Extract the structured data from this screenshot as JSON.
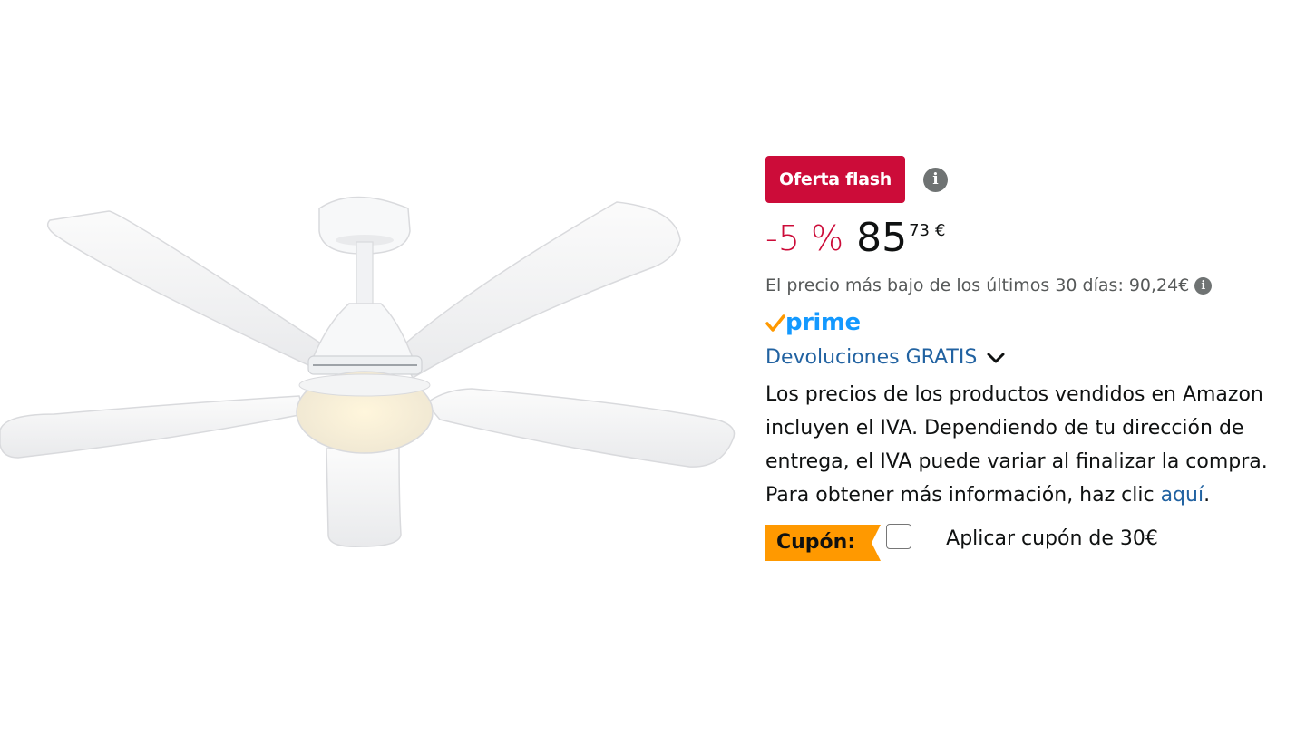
{
  "badge": {
    "label": "Oferta flash",
    "info": "i"
  },
  "price": {
    "discount": "-5 %",
    "whole": "85",
    "fraction": "73",
    "currency": "€"
  },
  "lowest_price": {
    "label": "El precio más bajo de los últimos 30 días:",
    "value": "90,24€",
    "info": "i"
  },
  "prime": {
    "label": "prime"
  },
  "returns": {
    "label": "Devoluciones GRATIS"
  },
  "vat": {
    "text": "Los precios de los productos vendidos en Amazon incluyen el IVA. Dependiendo de tu dirección de entrega, el IVA puede variar al finalizar la compra. Para obtener más información, haz clic ",
    "link": "aquí",
    "end": "."
  },
  "coupon": {
    "label": "Cupón:",
    "text": "Aplicar cupón de 30€"
  },
  "colors": {
    "badge_red": "#cc0c39",
    "link_blue": "#2162a1",
    "prime_blue": "#1399ff",
    "coupon_orange": "#ff9900"
  }
}
